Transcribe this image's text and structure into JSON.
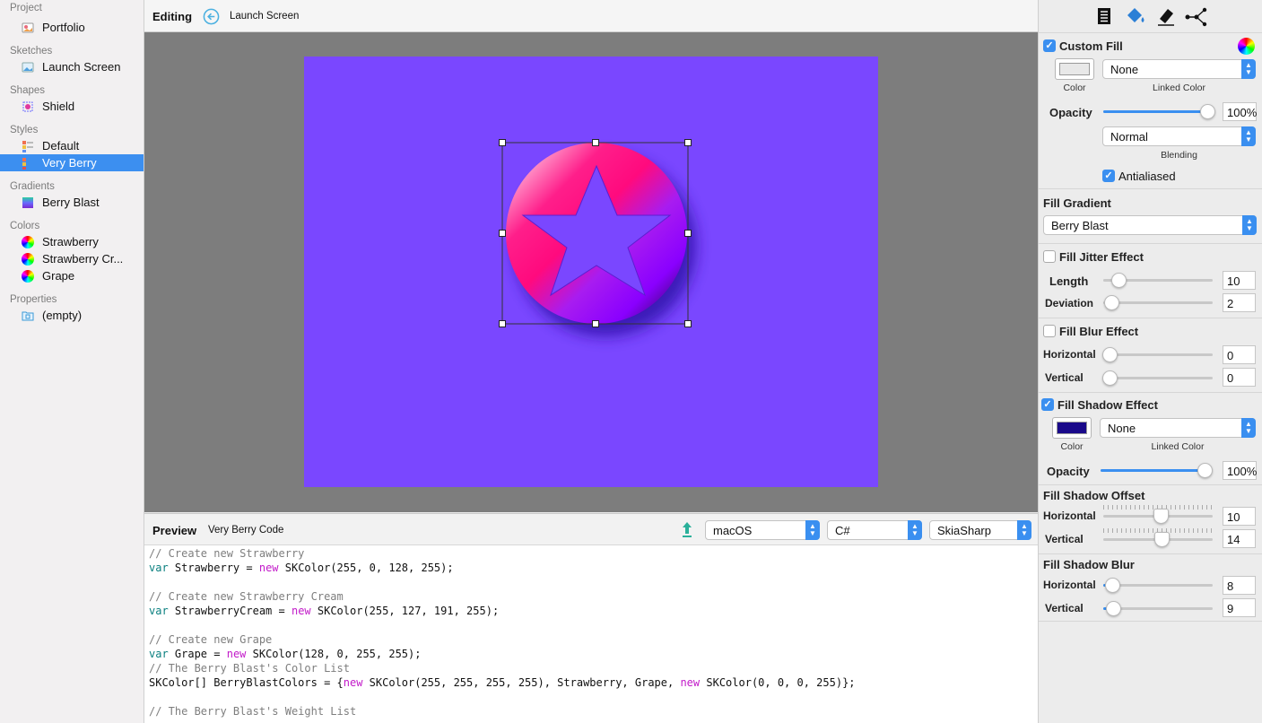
{
  "sidebar": {
    "sections": [
      {
        "title": "Project",
        "items": [
          {
            "label": "Portfolio",
            "icon": "portfolio-icon"
          }
        ]
      },
      {
        "title": "Sketches",
        "items": [
          {
            "label": "Launch Screen",
            "icon": "sketch-icon"
          }
        ]
      },
      {
        "title": "Shapes",
        "items": [
          {
            "label": "Shield",
            "icon": "shape-icon"
          }
        ]
      },
      {
        "title": "Styles",
        "items": [
          {
            "label": "Default",
            "icon": "style-icon"
          },
          {
            "label": "Very Berry",
            "icon": "style-icon",
            "selected": true
          }
        ]
      },
      {
        "title": "Gradients",
        "items": [
          {
            "label": "Berry Blast",
            "icon": "gradient-icon"
          }
        ]
      },
      {
        "title": "Colors",
        "items": [
          {
            "label": "Strawberry",
            "icon": "color-wheel-icon"
          },
          {
            "label": "Strawberry Cr...",
            "icon": "color-wheel-icon"
          },
          {
            "label": "Grape",
            "icon": "color-wheel-icon"
          }
        ]
      },
      {
        "title": "Properties",
        "items": [
          {
            "label": "(empty)",
            "icon": "folder-icon"
          }
        ]
      }
    ]
  },
  "topbar": {
    "title": "Editing",
    "subtitle": "Launch Screen"
  },
  "canvas": {
    "background": "#7a47ff"
  },
  "preview": {
    "title": "Preview",
    "subtitle": "Very Berry Code",
    "platform": "macOS",
    "language": "C#",
    "library": "SkiaSharp",
    "code": [
      [
        {
          "t": "// Create new Strawberry",
          "c": "cmt"
        }
      ],
      [
        {
          "t": "var",
          "c": "kw-var"
        },
        {
          "t": " Strawberry = "
        },
        {
          "t": "new",
          "c": "kw-new"
        },
        {
          "t": " SKColor(255, 0, 128, 255);"
        }
      ],
      [],
      [
        {
          "t": "// Create new Strawberry Cream",
          "c": "cmt"
        }
      ],
      [
        {
          "t": "var",
          "c": "kw-var"
        },
        {
          "t": " StrawberryCream = "
        },
        {
          "t": "new",
          "c": "kw-new"
        },
        {
          "t": " SKColor(255, 127, 191, 255);"
        }
      ],
      [],
      [
        {
          "t": "// Create new Grape",
          "c": "cmt"
        }
      ],
      [
        {
          "t": "var",
          "c": "kw-var"
        },
        {
          "t": " Grape = "
        },
        {
          "t": "new",
          "c": "kw-new"
        },
        {
          "t": " SKColor(128, 0, 255, 255);"
        }
      ],
      [
        {
          "t": "// The Berry Blast's Color List",
          "c": "cmt"
        }
      ],
      [
        {
          "t": "SKColor[] BerryBlastColors = {"
        },
        {
          "t": "new",
          "c": "kw-new"
        },
        {
          "t": " SKColor(255, 255, 255, 255), Strawberry, Grape, "
        },
        {
          "t": "new",
          "c": "kw-new"
        },
        {
          "t": " SKColor(0, 0, 0, 255)};"
        }
      ],
      [],
      [
        {
          "t": "// The Berry Blast's Weight List",
          "c": "cmt"
        }
      ]
    ]
  },
  "inspector": {
    "custom_fill": {
      "title": "Custom Fill",
      "checked": true,
      "color_label": "Color",
      "color": "#e8e8e8",
      "linked_value": "None",
      "linked_label": "Linked Color",
      "opacity_label": "Opacity",
      "opacity": "100%",
      "blending_value": "Normal",
      "blending_label": "Blending",
      "antialiased_label": "Antialiased",
      "antialiased": true
    },
    "fill_gradient": {
      "title": "Fill Gradient",
      "value": "Berry Blast"
    },
    "jitter": {
      "title": "Fill Jitter Effect",
      "checked": false,
      "length_label": "Length",
      "length": "10",
      "deviation_label": "Deviation",
      "deviation": "2"
    },
    "blur": {
      "title": "Fill Blur Effect",
      "checked": false,
      "horizontal_label": "Horizontal",
      "horizontal": "0",
      "vertical_label": "Vertical",
      "vertical": "0"
    },
    "shadow": {
      "title": "Fill Shadow Effect",
      "checked": true,
      "color_label": "Color",
      "color": "#1a0a8a",
      "linked_value": "None",
      "linked_label": "Linked Color",
      "opacity_label": "Opacity",
      "opacity": "100%"
    },
    "shadow_offset": {
      "title": "Fill Shadow Offset",
      "horizontal_label": "Horizontal",
      "horizontal": "10",
      "vertical_label": "Vertical",
      "vertical": "14"
    },
    "shadow_blur": {
      "title": "Fill Shadow Blur",
      "horizontal_label": "Horizontal",
      "horizontal": "8",
      "vertical_label": "Vertical",
      "vertical": "9"
    }
  }
}
